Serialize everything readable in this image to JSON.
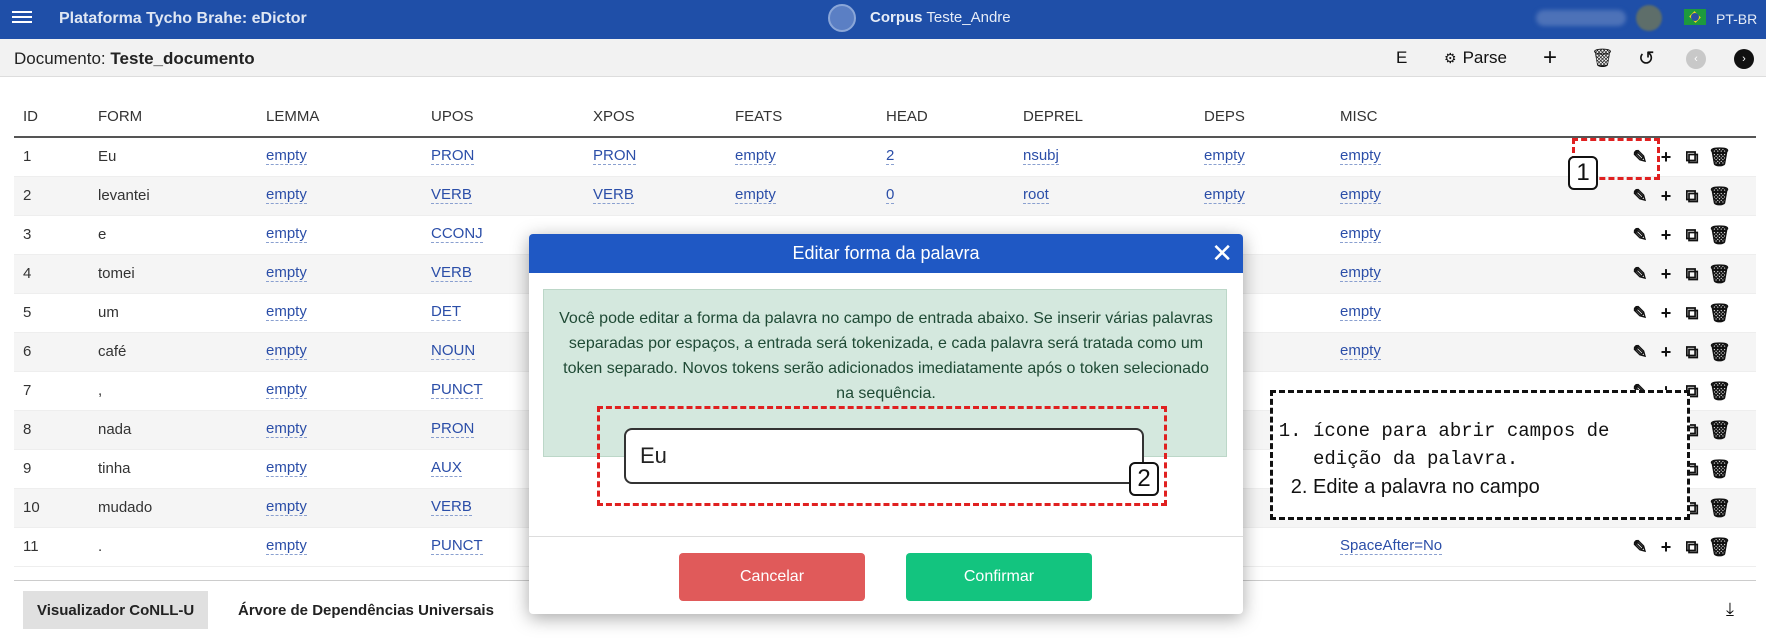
{
  "topbar": {
    "app_title": "Plataforma Tycho Brahe: eDictor",
    "corpus_label": "Corpus",
    "corpus_name": "Teste_Andre",
    "language": "PT-BR"
  },
  "document": {
    "label": "Documento:",
    "name": "Teste_documento",
    "toolbar": {
      "e_label": "E",
      "parse_label": "Parse"
    }
  },
  "table": {
    "headers": [
      "ID",
      "FORM",
      "LEMMA",
      "UPOS",
      "XPOS",
      "FEATS",
      "HEAD",
      "DEPREL",
      "DEPS",
      "MISC"
    ],
    "rows": [
      [
        "1",
        "Eu",
        "empty",
        "PRON",
        "PRON",
        "empty",
        "2",
        "nsubj",
        "empty",
        "empty"
      ],
      [
        "2",
        "levantei",
        "empty",
        "VERB",
        "VERB",
        "empty",
        "0",
        "root",
        "empty",
        "empty"
      ],
      [
        "3",
        "e",
        "empty",
        "CCONJ",
        "",
        "",
        "",
        "",
        "",
        "empty"
      ],
      [
        "4",
        "tomei",
        "empty",
        "VERB",
        "",
        "",
        "",
        "",
        "",
        "empty"
      ],
      [
        "5",
        "um",
        "empty",
        "DET",
        "",
        "",
        "",
        "",
        "",
        "empty"
      ],
      [
        "6",
        "café",
        "empty",
        "NOUN",
        "",
        "",
        "",
        "",
        "",
        "empty"
      ],
      [
        "7",
        ",",
        "empty",
        "PUNCT",
        "",
        "",
        "",
        "",
        "",
        ""
      ],
      [
        "8",
        "nada",
        "empty",
        "PRON",
        "",
        "",
        "",
        "",
        "",
        ""
      ],
      [
        "9",
        "tinha",
        "empty",
        "AUX",
        "",
        "",
        "",
        "",
        "",
        ""
      ],
      [
        "10",
        "mudado",
        "empty",
        "VERB",
        "",
        "",
        "",
        "",
        "",
        ""
      ],
      [
        "11",
        ".",
        "empty",
        "PUNCT",
        "",
        "",
        "",
        "",
        "",
        "SpaceAfter=No"
      ]
    ]
  },
  "bottom_tabs": {
    "conllu": "Visualizador CoNLL-U",
    "tree": "Árvore de Dependências Universais"
  },
  "modal": {
    "title": "Editar forma da palavra",
    "info": "Você pode editar a forma da palavra no campo de entrada abaixo. Se inserir várias palavras separadas por espaços, a entrada será tokenizada, e cada palavra será tratada como um token separado. Novos tokens serão adicionados imediatamente após o token selecionado na sequência.",
    "input_value": "Eu",
    "cancel_label": "Cancelar",
    "confirm_label": "Confirmar"
  },
  "annotations": {
    "badge_1": "1",
    "badge_2": "2",
    "legend": [
      "ícone para abrir campos de edição da palavra.",
      "Edite a palavra no campo"
    ]
  },
  "colors": {
    "topbar": "#1f4fa8",
    "modal_header": "#1f58c4",
    "cancel": "#e05a5a",
    "confirm": "#13c47f",
    "annotation_red": "#e02020"
  }
}
